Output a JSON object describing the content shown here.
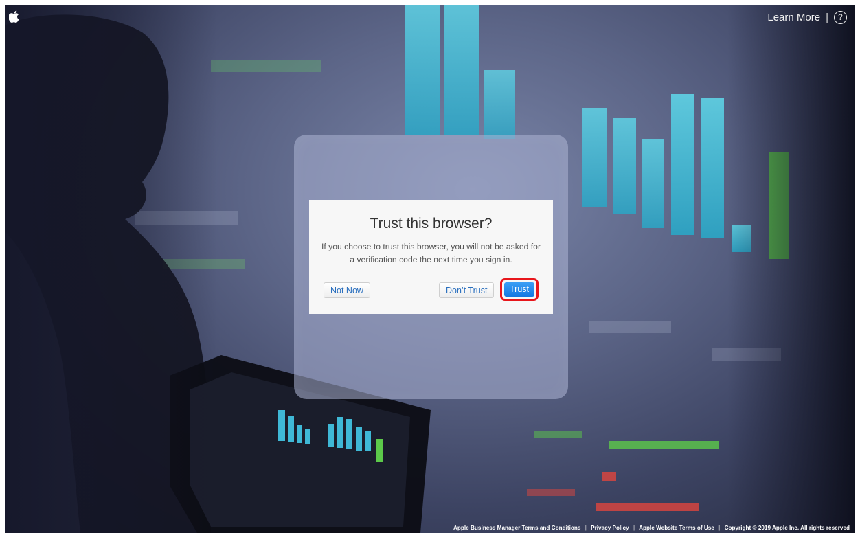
{
  "header": {
    "learn_more": "Learn More",
    "separator": "|",
    "help_symbol": "?"
  },
  "dialog": {
    "title": "Trust this browser?",
    "body": "If you choose to trust this browser, you will not be asked for a verification code the next time you sign in.",
    "not_now_label": "Not Now",
    "dont_trust_label": "Don’t Trust",
    "trust_label": "Trust",
    "highlight_color": "#e8161b",
    "primary_color": "#1478e2"
  },
  "footer": {
    "links": [
      "Apple Business Manager Terms and Conditions",
      "Privacy Policy",
      "Apple Website Terms of Use"
    ],
    "separator": "|",
    "copyright": "Copyright © 2019 Apple Inc. All rights reserved"
  },
  "icons": {
    "logo": "apple-logo-icon",
    "help": "help-icon"
  }
}
